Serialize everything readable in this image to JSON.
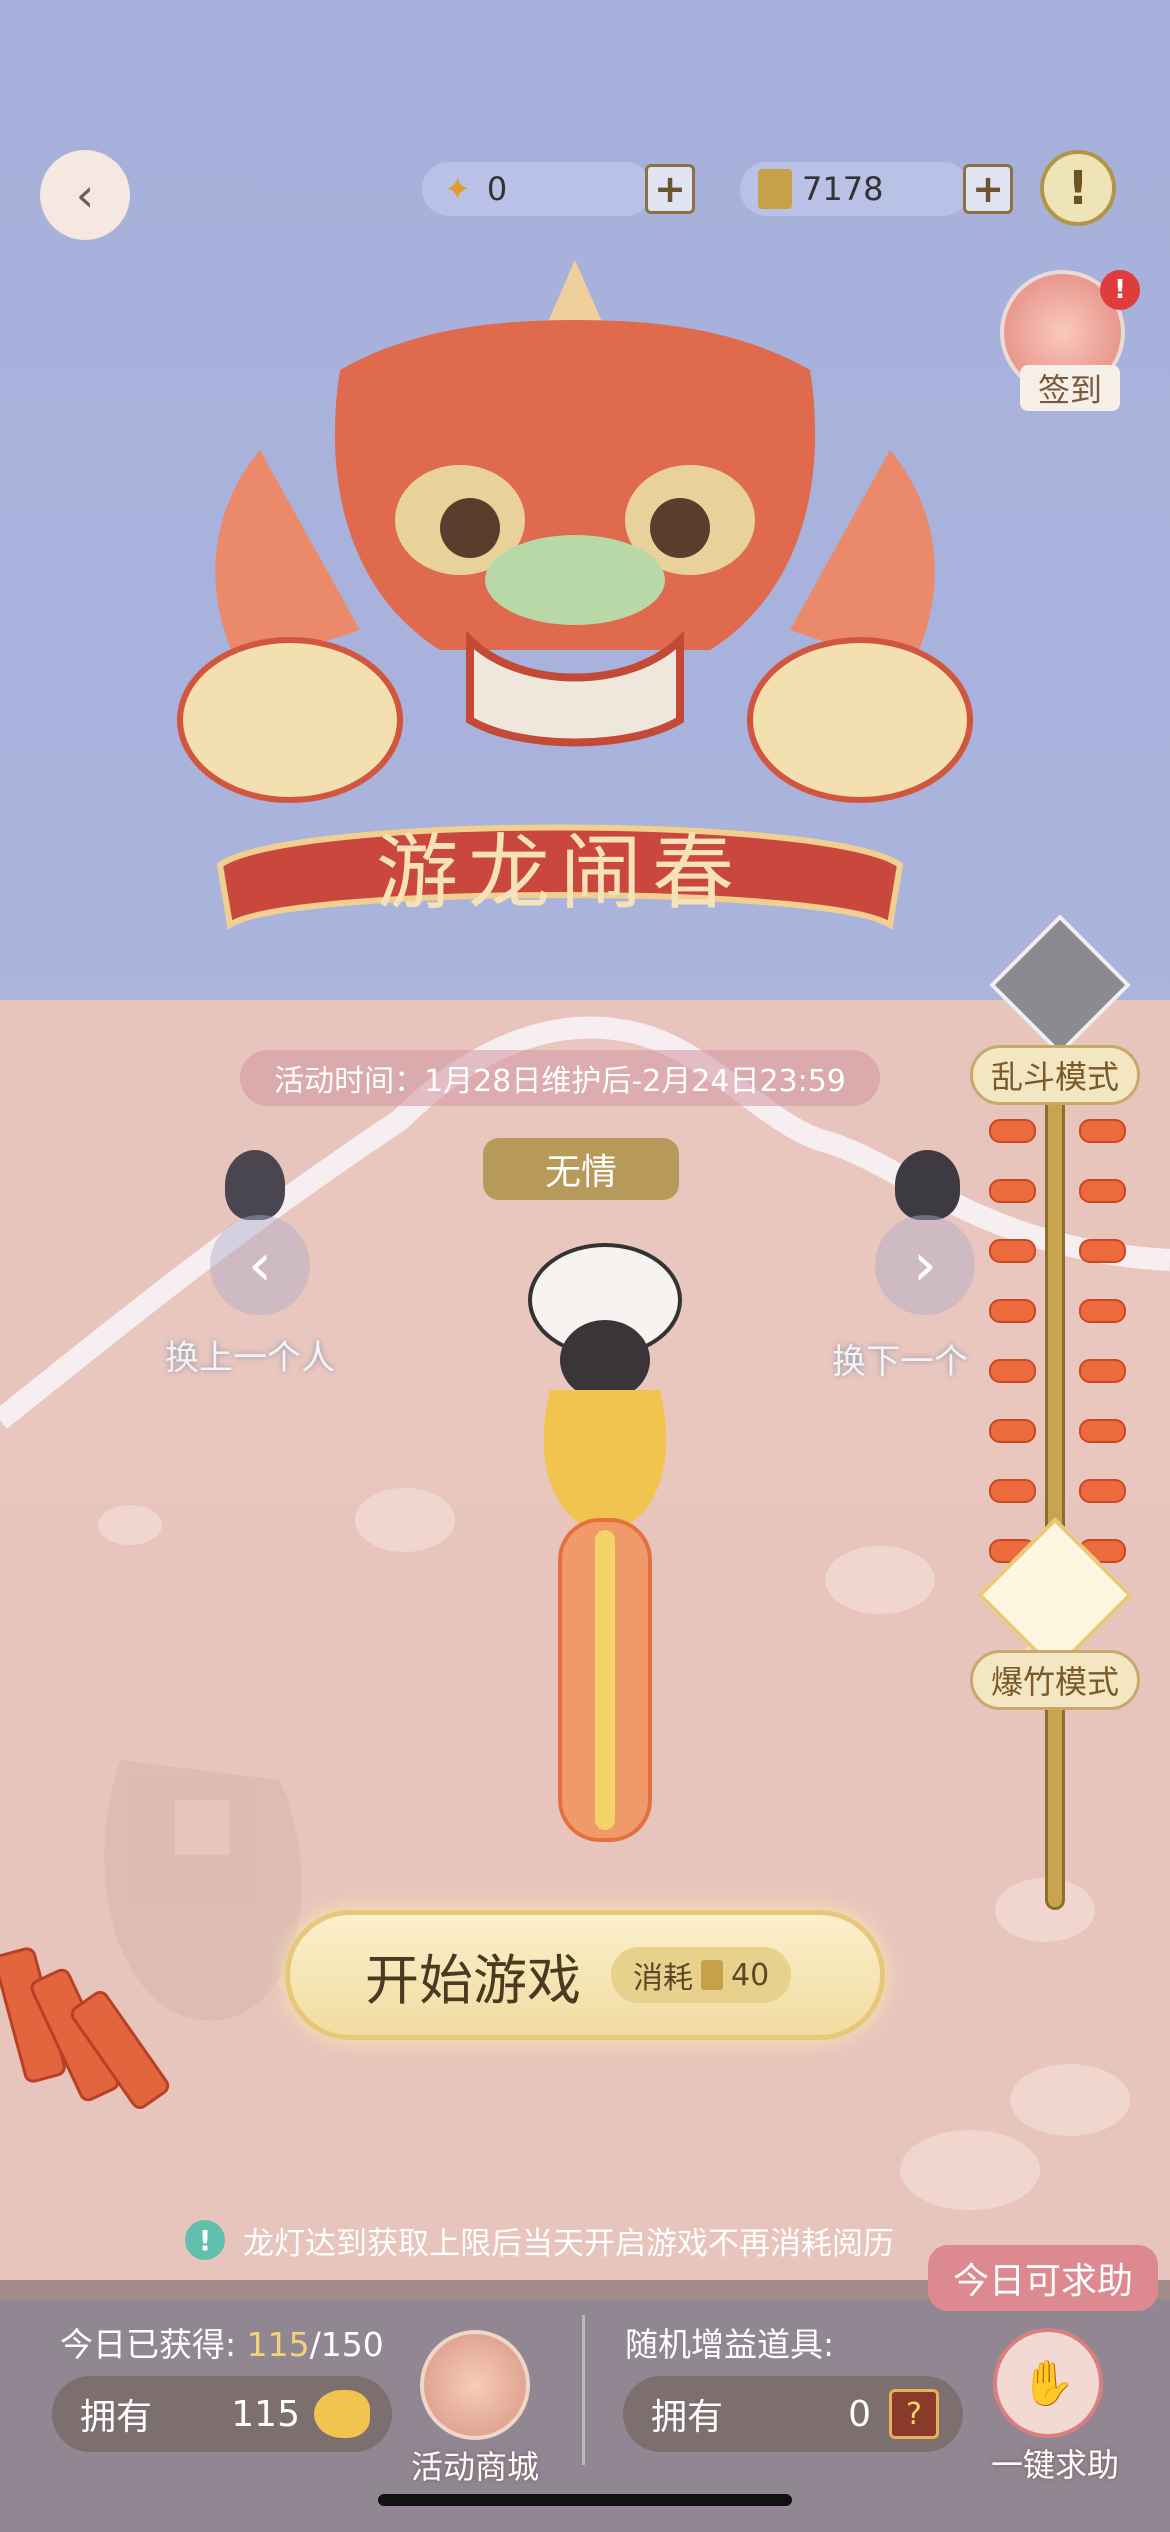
{
  "header": {
    "currency_a_value": "0",
    "currency_b_value": "7178",
    "plus_label": "+",
    "info_label": "!"
  },
  "signin": {
    "label": "签到",
    "badge": "!"
  },
  "title_banner": {
    "text": "游龙闹春"
  },
  "event_time": "活动时间：1月28日维护后-2月24日23:59",
  "character": {
    "name": "无情",
    "prev_label": "换上一个人",
    "next_label": "换下一个"
  },
  "modes": {
    "brawl": "乱斗模式",
    "firecracker": "爆竹模式"
  },
  "start": {
    "label": "开始游戏",
    "cost_prefix": "消耗",
    "cost_value": "40"
  },
  "notice": "龙灯达到获取上限后当天开启游戏不再消耗阅历",
  "bottom": {
    "today_label": "今日已获得:",
    "today_current": "115",
    "today_sep": "/",
    "today_max": "150",
    "own_label": "拥有",
    "own_value": "115",
    "shop_label": "活动商城",
    "random_label": "随机增益道具:",
    "own2_label": "拥有",
    "own2_value": "0",
    "help_tip": "今日可求助",
    "help_label": "一键求助"
  },
  "colors": {
    "accent_gold": "#f4d27a",
    "banner_red": "#c9473c",
    "bg_blue": "#a9b3dc",
    "bg_pink": "#e7c4bc"
  }
}
